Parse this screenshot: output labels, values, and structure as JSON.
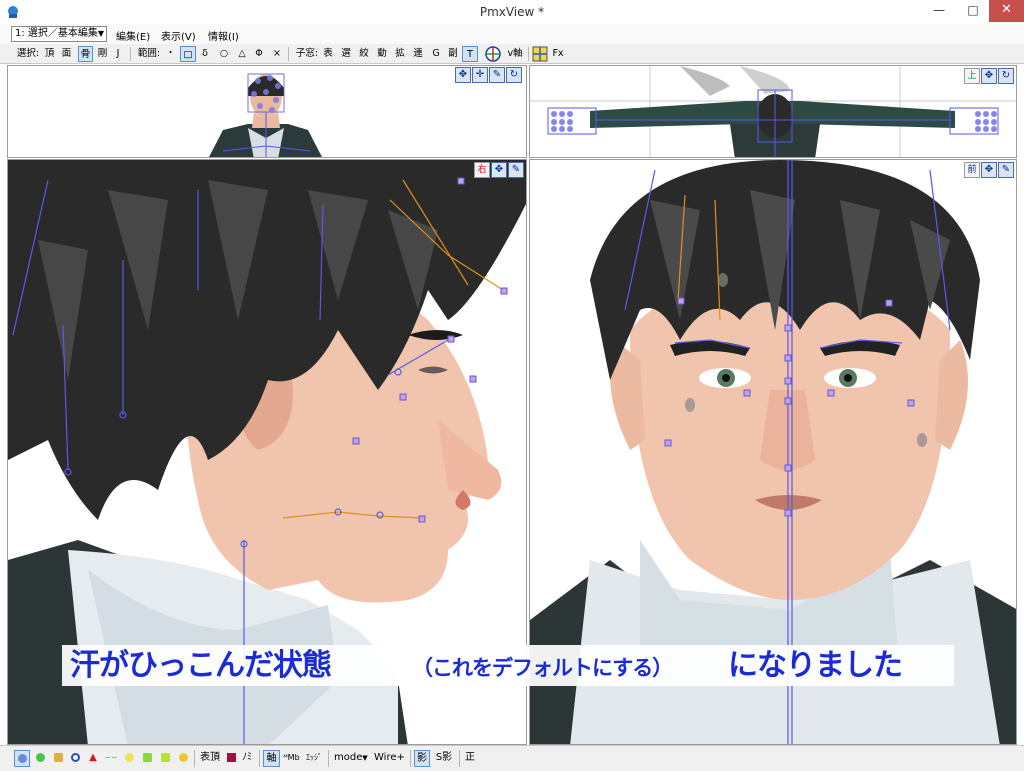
{
  "window": {
    "title": "PmxView *",
    "minimize": "—",
    "maximize": "□",
    "close": "✕"
  },
  "menubar": {
    "mode_select": "1: 選択／基本編集",
    "items": [
      "編集(E)",
      "表示(V)",
      "情報(I)"
    ]
  },
  "toolbar": {
    "select_label": "選択:",
    "select_buttons": [
      "頂",
      "面",
      "骨",
      "剛",
      "J"
    ],
    "range_label": "範囲:",
    "range_buttons": [
      "・",
      "□",
      "δ",
      "○",
      "△",
      "Φ",
      "×"
    ],
    "child_label": "子窓:",
    "child_buttons": [
      "表",
      "選",
      "絞",
      "動",
      "拡",
      "連",
      "G",
      "副",
      "T"
    ],
    "vaxis_label": "v軸",
    "fx_label": "Fx"
  },
  "viewports": {
    "top_right_label": "上",
    "bottom_left_label": "右",
    "bottom_right_label": "前"
  },
  "caption": {
    "main": "汗がひっこんだ状態",
    "paren": "（これをデフォルトにする）",
    "end": "になりました"
  },
  "statusbar": {
    "surface_label": "表頂",
    "no_label": "ﾉﾐ",
    "axis_label": "軸",
    "uvmorph_label": "ᴹMb",
    "edge_label": "ｴｯｼﾞ",
    "mode_label": "mode",
    "wire_label": "Wire+",
    "shadow_label": "影",
    "sshadow_label": "S影",
    "correct_label": "正"
  },
  "colors": {
    "accent": "#1c2bd6",
    "close": "#c7504d",
    "bone": "#5a5ae6",
    "bone_orange": "#e0901a",
    "hair": "#2a2a2a",
    "skin": "#f1c4ae"
  }
}
